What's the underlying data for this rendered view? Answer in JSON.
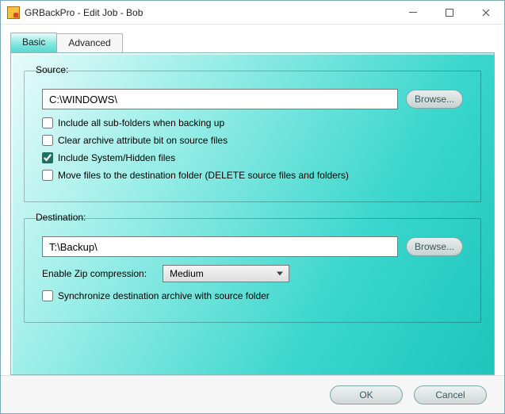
{
  "window": {
    "title": "GRBackPro - Edit Job - Bob"
  },
  "tabs": {
    "basic": "Basic",
    "advanced": "Advanced"
  },
  "source": {
    "legend": "Source:",
    "path": "C:\\WINDOWS\\",
    "browse": "Browse...",
    "opt_include_sub": "Include all sub-folders when backing up",
    "opt_clear_archive": "Clear archive attribute bit on source files",
    "opt_include_hidden": "Include System/Hidden files",
    "opt_move_delete": "Move files to the destination folder (DELETE source files and folders)",
    "chk_include_sub": false,
    "chk_clear_archive": false,
    "chk_include_hidden": true,
    "chk_move_delete": false
  },
  "destination": {
    "legend": "Destination:",
    "path": "T:\\Backup\\",
    "browse": "Browse...",
    "zip_label": "Enable Zip compression:",
    "zip_value": "Medium",
    "opt_sync": "Synchronize destination archive with source folder",
    "chk_sync": false
  },
  "footer": {
    "ok": "OK",
    "cancel": "Cancel"
  }
}
